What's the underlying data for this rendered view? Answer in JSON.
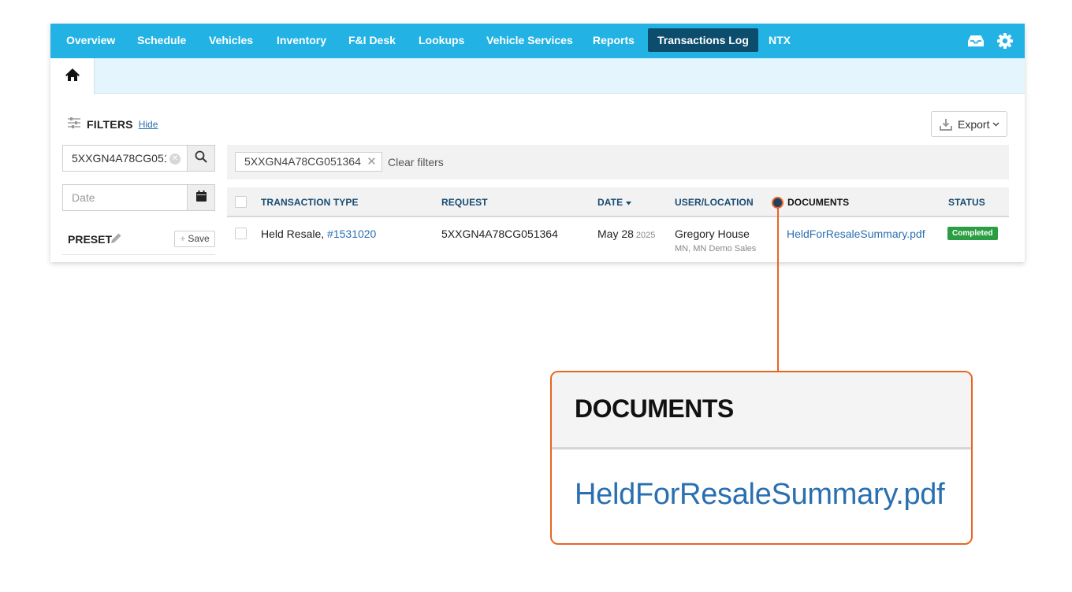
{
  "nav": {
    "items": [
      "Overview",
      "Schedule",
      "Vehicles",
      "Inventory",
      "F&I Desk",
      "Lookups",
      "Vehicle Services",
      "Reports",
      "Transactions Log",
      "NTX"
    ],
    "active": "Transactions Log",
    "right_icons": [
      "inbox-icon",
      "gear-icon"
    ],
    "bar_color": "#22b3e4",
    "active_color": "#0c4d6e"
  },
  "tabs": {
    "home_icon": "home-icon"
  },
  "filters": {
    "title": "FILTERS",
    "hide_label": "Hide",
    "vin_value": "5XXGN4A78CG051",
    "date_placeholder": "Date",
    "preset_label": "PRESET",
    "save_label": "Save"
  },
  "toolbar": {
    "export_label": "Export"
  },
  "active_filters": {
    "chip_label": "5XXGN4A78CG051364",
    "clear_label": "Clear filters"
  },
  "table": {
    "columns": {
      "type": "TRANSACTION TYPE",
      "request": "REQUEST",
      "date": "DATE",
      "user": "USER/LOCATION",
      "documents": "DOCUMENTS",
      "status": "STATUS"
    },
    "rows": [
      {
        "type": "Held Resale,",
        "type_link": "#1531020",
        "request": "5XXGN4A78CG051364",
        "date": "May 28",
        "year": "2025",
        "user": "Gregory House",
        "location": "MN, MN Demo Sales",
        "document": "HeldForResaleSummary.pdf",
        "status": "Completed"
      }
    ]
  },
  "callout": {
    "title": "DOCUMENTS",
    "link": "HeldForResaleSummary.pdf",
    "accent_color": "#e86524"
  }
}
